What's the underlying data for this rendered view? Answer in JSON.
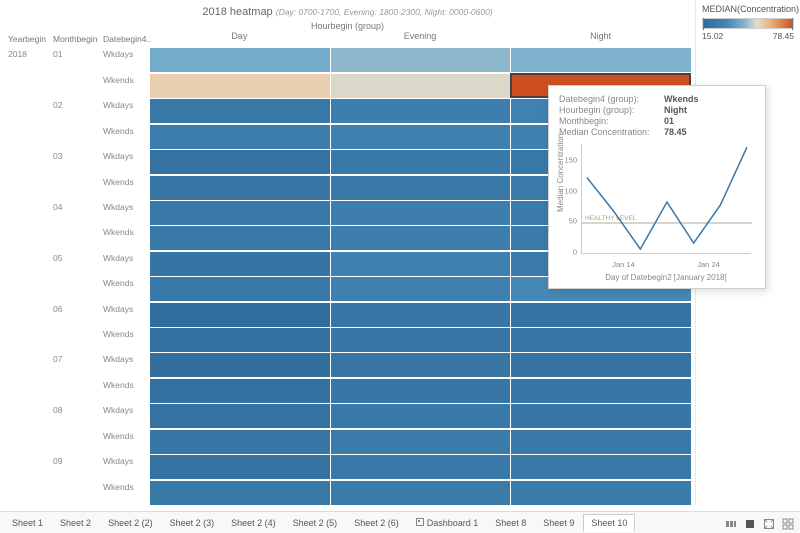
{
  "title": "2018 heatmap",
  "subtitle": "(Day: 0700-1700, Evening: 1800-2300, Night: 0000-0600)",
  "col_header_group": "Hourbegin (group)",
  "row_header_labels": {
    "year": "Yearbegin",
    "month": "Monthbegin",
    "date": "Datebegin4.."
  },
  "columns": [
    "Day",
    "Evening",
    "Night"
  ],
  "year": "2018",
  "legend": {
    "title": "MEDIAN(Concentration)",
    "min": "15.02",
    "max": "78.45"
  },
  "tooltip": {
    "fields": [
      {
        "k": "Datebegin4 (group):",
        "v": "Wkends"
      },
      {
        "k": "Hourbegin (group):",
        "v": "Night"
      },
      {
        "k": "Monthbegin:",
        "v": "01"
      },
      {
        "k": "Median Concentration:",
        "v": "78.45"
      }
    ],
    "ylabel": "Median Concentration",
    "xlabel": "Day of Datebegin2 [January 2018]",
    "yticks": [
      "0",
      "50",
      "100",
      "150"
    ],
    "xticks": [
      "Jan 14",
      "Jan 24"
    ],
    "ref_label": "HEALTHY LEVEL"
  },
  "tabs": [
    "Sheet 1",
    "Sheet 2",
    "Sheet 2 (2)",
    "Sheet 2 (3)",
    "Sheet 2 (4)",
    "Sheet 2 (5)",
    "Sheet 2 (6)",
    "Dashboard 1",
    "Sheet 8",
    "Sheet 9",
    "Sheet 10"
  ],
  "active_tab": "Sheet 10",
  "chart_data": {
    "type": "heatmap",
    "title": "2018 heatmap",
    "x_dimension": "Hourbegin (group)",
    "x_categories": [
      "Day",
      "Evening",
      "Night"
    ],
    "row_dimensions": [
      "Yearbegin",
      "Monthbegin",
      "Datebegin4 (group)"
    ],
    "color_measure": "MEDIAN(Concentration)",
    "color_scale": {
      "min": 15.02,
      "max": 78.45
    },
    "rows": [
      {
        "year": "2018",
        "month": "01",
        "date_group": "Wkdays",
        "values": {
          "Day": 42,
          "Evening": 45,
          "Night": 44
        }
      },
      {
        "year": "2018",
        "month": "01",
        "date_group": "Wkends",
        "values": {
          "Day": 56,
          "Evening": 52,
          "Night": 78.45
        }
      },
      {
        "year": "2018",
        "month": "02",
        "date_group": "Wkdays",
        "values": {
          "Day": 23,
          "Evening": 27,
          "Night": 29
        }
      },
      {
        "year": "2018",
        "month": "02",
        "date_group": "Wkends",
        "values": {
          "Day": 26,
          "Evening": 28,
          "Night": 28
        }
      },
      {
        "year": "2018",
        "month": "03",
        "date_group": "Wkdays",
        "values": {
          "Day": 20,
          "Evening": 24,
          "Night": 23
        }
      },
      {
        "year": "2018",
        "month": "03",
        "date_group": "Wkends",
        "values": {
          "Day": 22,
          "Evening": 24,
          "Night": 25
        }
      },
      {
        "year": "2018",
        "month": "04",
        "date_group": "Wkdays",
        "values": {
          "Day": 23,
          "Evening": 27,
          "Night": 25
        }
      },
      {
        "year": "2018",
        "month": "04",
        "date_group": "Wkends",
        "values": {
          "Day": 23,
          "Evening": 27,
          "Night": 25
        }
      },
      {
        "year": "2018",
        "month": "05",
        "date_group": "Wkdays",
        "values": {
          "Day": 21,
          "Evening": 28,
          "Night": 25
        }
      },
      {
        "year": "2018",
        "month": "05",
        "date_group": "Wkends",
        "values": {
          "Day": 24,
          "Evening": 28,
          "Night": 32
        }
      },
      {
        "year": "2018",
        "month": "06",
        "date_group": "Wkdays",
        "values": {
          "Day": 17,
          "Evening": 22,
          "Night": 20
        }
      },
      {
        "year": "2018",
        "month": "06",
        "date_group": "Wkends",
        "values": {
          "Day": 19,
          "Evening": 22,
          "Night": 22
        }
      },
      {
        "year": "2018",
        "month": "07",
        "date_group": "Wkdays",
        "values": {
          "Day": 18,
          "Evening": 22,
          "Night": 21
        }
      },
      {
        "year": "2018",
        "month": "07",
        "date_group": "Wkends",
        "values": {
          "Day": 19,
          "Evening": 22,
          "Night": 22
        }
      },
      {
        "year": "2018",
        "month": "08",
        "date_group": "Wkdays",
        "values": {
          "Day": 20,
          "Evening": 24,
          "Night": 22
        }
      },
      {
        "year": "2018",
        "month": "08",
        "date_group": "Wkends",
        "values": {
          "Day": 22,
          "Evening": 25,
          "Night": 24
        }
      },
      {
        "year": "2018",
        "month": "09",
        "date_group": "Wkdays",
        "values": {
          "Day": 20,
          "Evening": 24,
          "Night": 23
        }
      },
      {
        "year": "2018",
        "month": "09",
        "date_group": "Wkends",
        "values": {
          "Day": 23,
          "Evening": 25,
          "Night": 25
        }
      }
    ],
    "tooltip_line_chart": {
      "type": "line",
      "ylabel": "Median Concentration",
      "xlabel": "Day of Datebegin2 [January 2018]",
      "reference_line": {
        "label": "HEALTHY LEVEL",
        "value": 50
      },
      "ylim": [
        0,
        180
      ],
      "points": [
        {
          "x": "Jan 7",
          "y": 125
        },
        {
          "x": "Jan 13",
          "y": 70
        },
        {
          "x": "Jan 14",
          "y": 8
        },
        {
          "x": "Jan 20",
          "y": 85
        },
        {
          "x": "Jan 21",
          "y": 18
        },
        {
          "x": "Jan 27",
          "y": 80
        },
        {
          "x": "Jan 28",
          "y": 175
        }
      ]
    }
  }
}
